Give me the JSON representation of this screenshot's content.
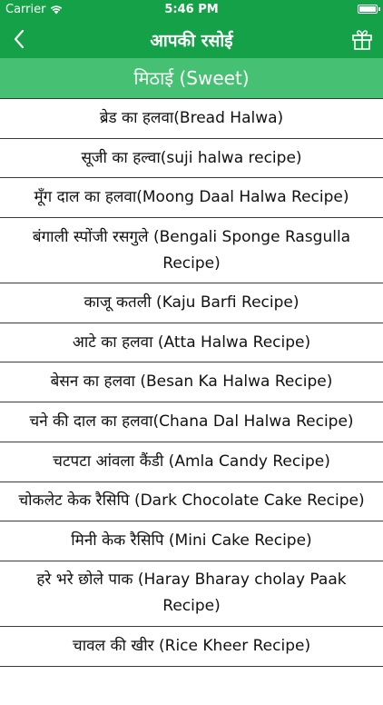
{
  "status_bar": {
    "carrier": "Carrier",
    "time": "5:46 PM"
  },
  "nav": {
    "title": "आपकी रसोई"
  },
  "section": {
    "title": "मिठाई (Sweet)"
  },
  "items": [
    {
      "label": "ब्रेड का हलवा(Bread Halwa)"
    },
    {
      "label": "सूजी का हल्वा(suji halwa recipe)"
    },
    {
      "label": "मूँग दाल का हलवा(Moong Daal Halwa Recipe)"
    },
    {
      "label": "बंगाली स्पोंजी रसगुले (Bengali Sponge Rasgulla Recipe)"
    },
    {
      "label": "काजू कतली (Kaju Barfi Recipe)"
    },
    {
      "label": "आटे का हलवा (Atta Halwa Recipe)"
    },
    {
      "label": "बेसन का हलवा (Besan Ka Halwa Recipe)"
    },
    {
      "label": "चने की दाल का हलवा(Chana Dal Halwa Recipe)"
    },
    {
      "label": "चटपटा आंवला कैंडी (Amla Candy Recipe)"
    },
    {
      "label": "चोकलेट केक रैसिपि (Dark Chocolate Cake Recipe)"
    },
    {
      "label": "मिनी केक रैसिपि (Mini Cake Recipe)"
    },
    {
      "label": "हरे भरे छोले पाक (Haray Bharay cholay Paak Recipe)"
    },
    {
      "label": "चावल की खीर (Rice Kheer Recipe)"
    },
    {
      "label": ""
    }
  ]
}
